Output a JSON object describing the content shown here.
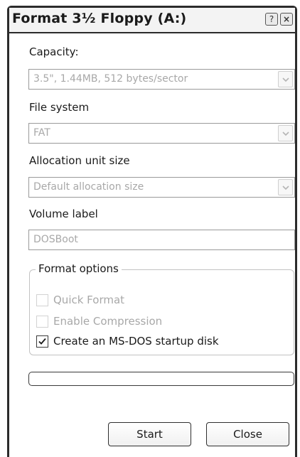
{
  "window": {
    "title": "Format 3½ Floppy (A:)",
    "help_button": "?",
    "close_button": "×"
  },
  "capacity": {
    "label": "Capacity:",
    "value": "3.5\",  1.44MB, 512 bytes/sector"
  },
  "file_system": {
    "label": "File system",
    "value": "FAT"
  },
  "allocation_unit": {
    "label": "Allocation unit size",
    "value": "Default allocation size"
  },
  "volume_label": {
    "label": "Volume label",
    "value": "DOSBoot"
  },
  "format_options": {
    "legend": "Format options",
    "quick_format": {
      "label": "Quick Format",
      "checked": false,
      "enabled": false
    },
    "enable_compression": {
      "label": "Enable Compression",
      "checked": false,
      "enabled": false
    },
    "msdos_startup": {
      "label": "Create an MS-DOS startup disk",
      "checked": true,
      "enabled": true
    }
  },
  "progress": {
    "fraction": 0
  },
  "buttons": {
    "start": "Start",
    "close": "Close"
  },
  "icons": {
    "dropdown": "chevron-down-icon",
    "checkmark": "check-icon"
  }
}
